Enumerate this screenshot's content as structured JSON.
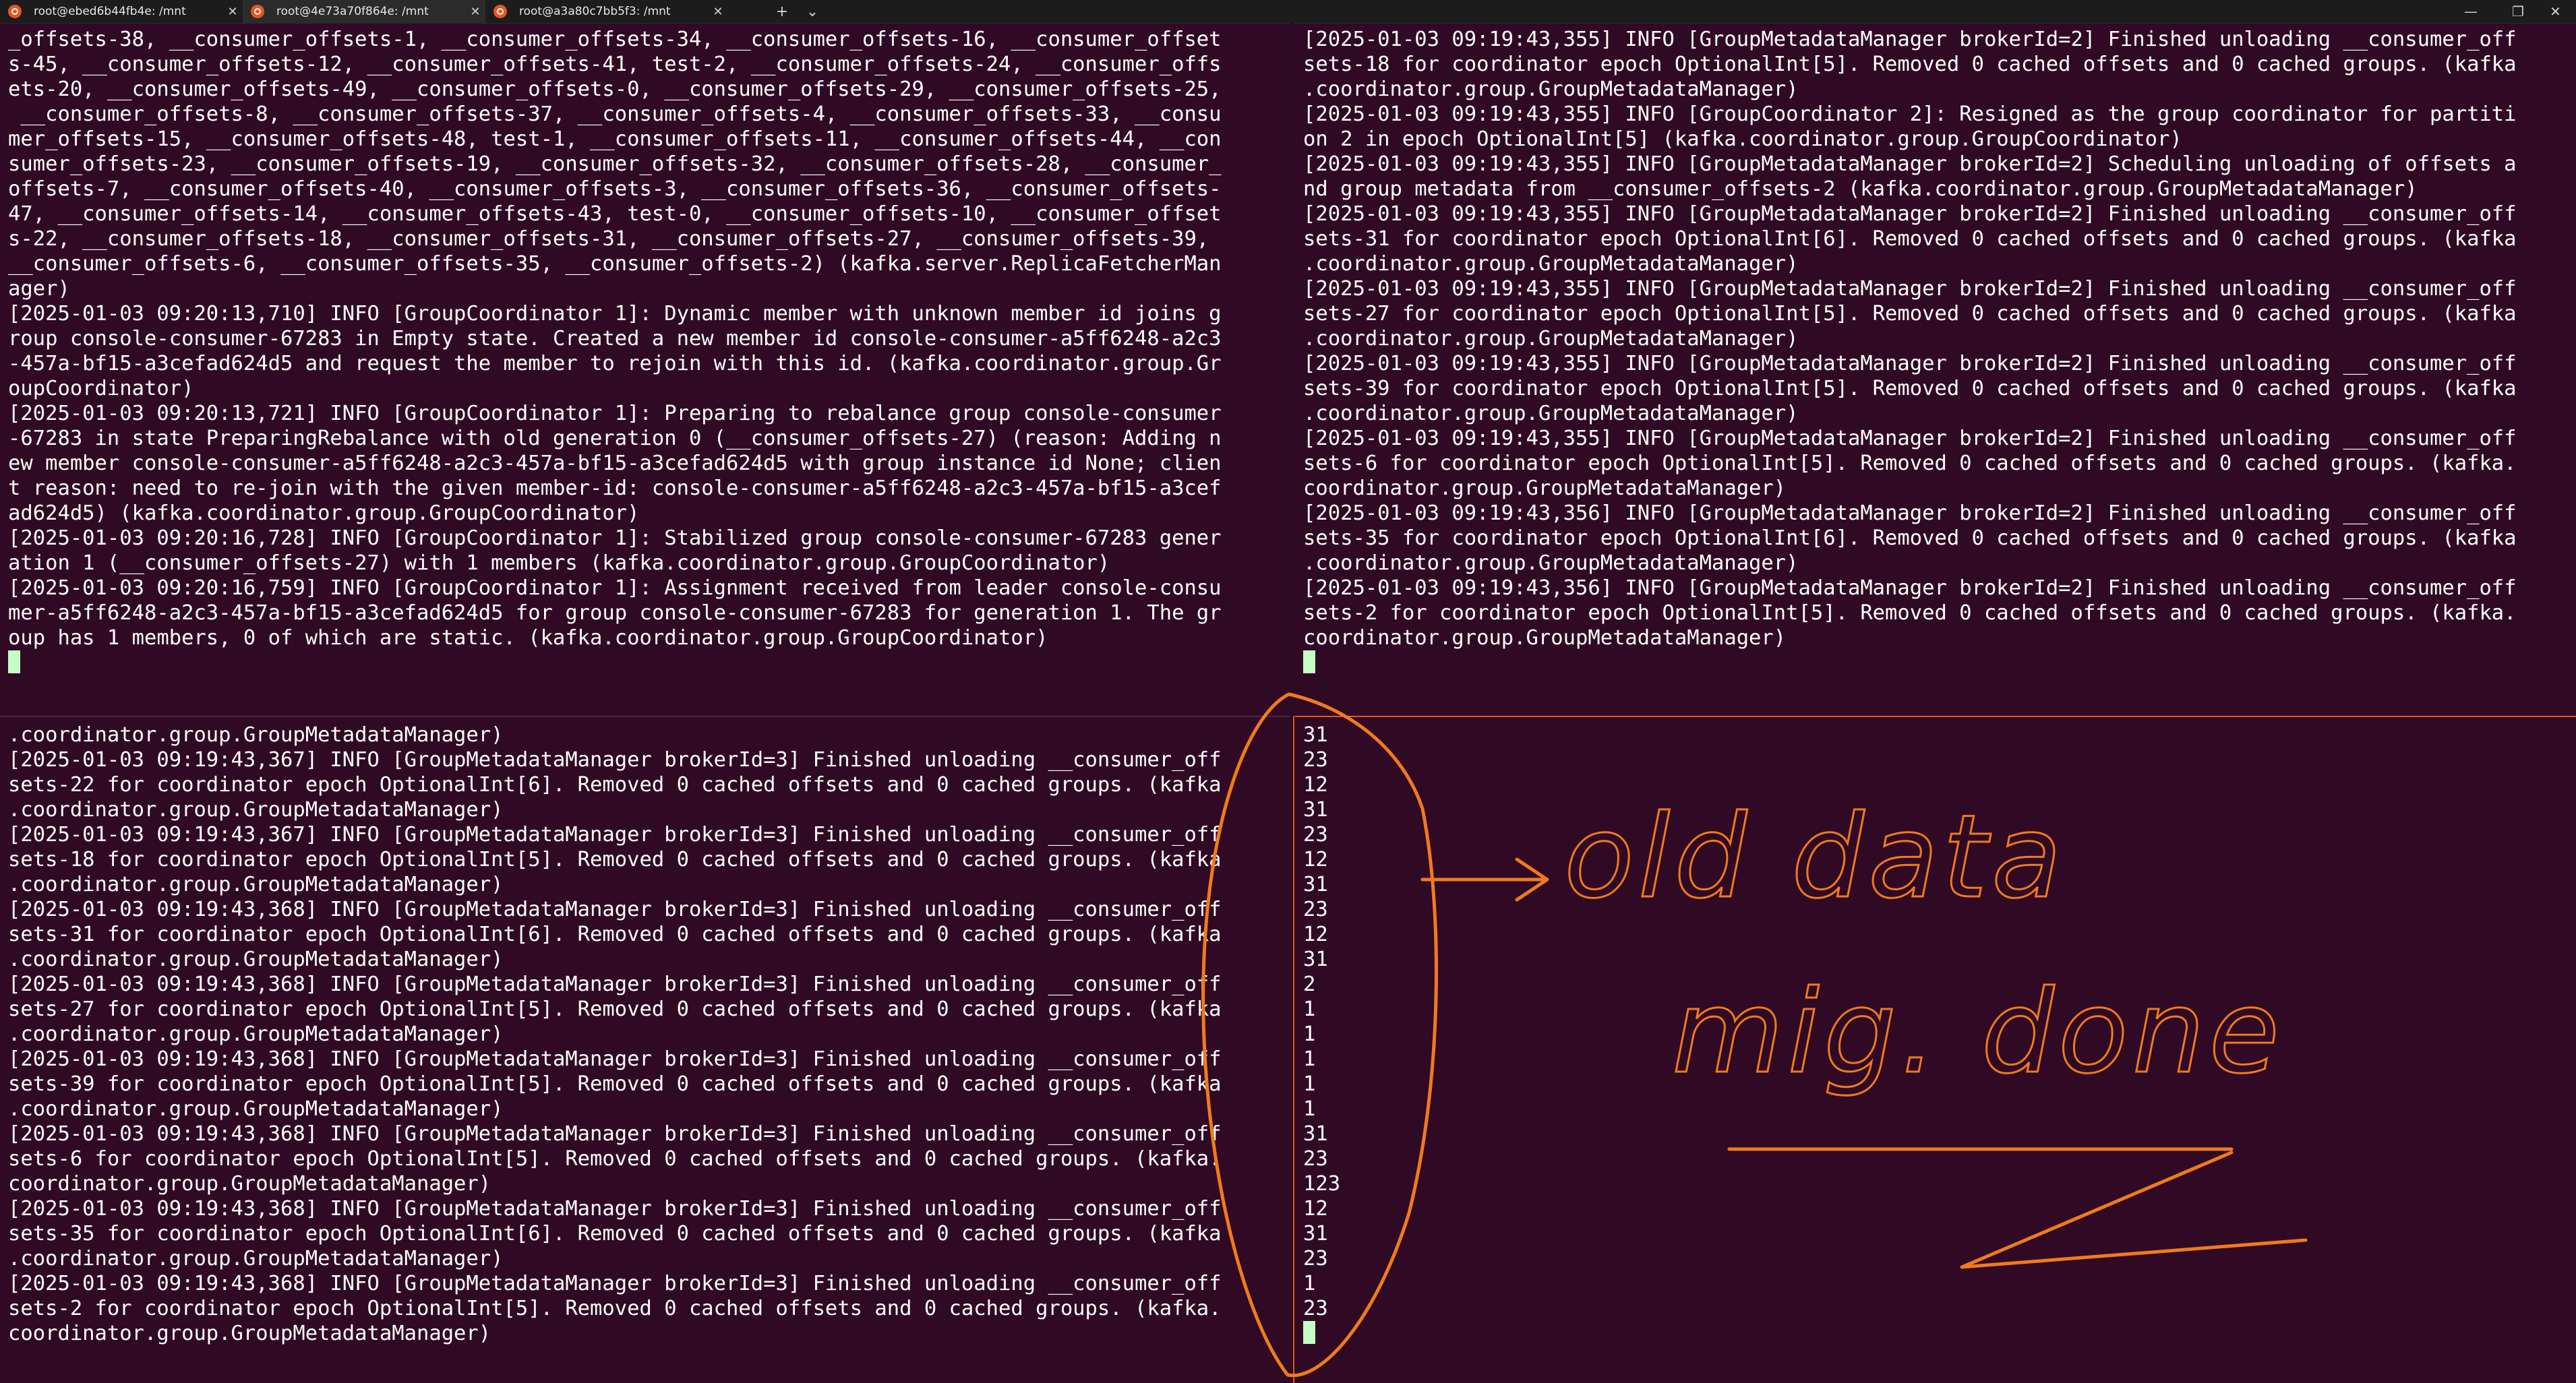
{
  "tabs": [
    {
      "label": "root@ebed6b44fb4e: /mnt",
      "close": "✕",
      "active": false
    },
    {
      "label": "root@4e73a70f864e: /mnt",
      "close": "✕",
      "active": true
    },
    {
      "label": "root@a3a80c7bb5f3: /mnt",
      "close": "✕",
      "active": false
    }
  ],
  "tab_actions": {
    "new_tab": "+",
    "dropdown": "⌄"
  },
  "window_controls": {
    "minimize": "—",
    "restore": "❐",
    "close": "✕"
  },
  "panes": {
    "top_left": "_offsets-38, __consumer_offsets-1, __consumer_offsets-34, __consumer_offsets-16, __consumer_offset\ns-45, __consumer_offsets-12, __consumer_offsets-41, test-2, __consumer_offsets-24, __consumer_offs\nets-20, __consumer_offsets-49, __consumer_offsets-0, __consumer_offsets-29, __consumer_offsets-25,\n __consumer_offsets-8, __consumer_offsets-37, __consumer_offsets-4, __consumer_offsets-33, __consu\nmer_offsets-15, __consumer_offsets-48, test-1, __consumer_offsets-11, __consumer_offsets-44, __con\nsumer_offsets-23, __consumer_offsets-19, __consumer_offsets-32, __consumer_offsets-28, __consumer_\noffsets-7, __consumer_offsets-40, __consumer_offsets-3, __consumer_offsets-36, __consumer_offsets-\n47, __consumer_offsets-14, __consumer_offsets-43, test-0, __consumer_offsets-10, __consumer_offset\ns-22, __consumer_offsets-18, __consumer_offsets-31, __consumer_offsets-27, __consumer_offsets-39,\n__consumer_offsets-6, __consumer_offsets-35, __consumer_offsets-2) (kafka.server.ReplicaFetcherMan\nager)\n[2025-01-03 09:20:13,710] INFO [GroupCoordinator 1]: Dynamic member with unknown member id joins g\nroup console-consumer-67283 in Empty state. Created a new member id console-consumer-a5ff6248-a2c3\n-457a-bf15-a3cefad624d5 and request the member to rejoin with this id. (kafka.coordinator.group.Gr\noupCoordinator)\n[2025-01-03 09:20:13,721] INFO [GroupCoordinator 1]: Preparing to rebalance group console-consumer\n-67283 in state PreparingRebalance with old generation 0 (__consumer_offsets-27) (reason: Adding n\new member console-consumer-a5ff6248-a2c3-457a-bf15-a3cefad624d5 with group instance id None; clien\nt reason: need to re-join with the given member-id: console-consumer-a5ff6248-a2c3-457a-bf15-a3cef\nad624d5) (kafka.coordinator.group.GroupCoordinator)\n[2025-01-03 09:20:16,728] INFO [GroupCoordinator 1]: Stabilized group console-consumer-67283 gener\nation 1 (__consumer_offsets-27) with 1 members (kafka.coordinator.group.GroupCoordinator)\n[2025-01-03 09:20:16,759] INFO [GroupCoordinator 1]: Assignment received from leader console-consu\nmer-a5ff6248-a2c3-457a-bf15-a3cefad624d5 for group console-consumer-67283 for generation 1. The gr\noup has 1 members, 0 of which are static. (kafka.coordinator.group.GroupCoordinator)",
    "top_right": "[2025-01-03 09:19:43,355] INFO [GroupMetadataManager brokerId=2] Finished unloading __consumer_off\nsets-18 for coordinator epoch OptionalInt[5]. Removed 0 cached offsets and 0 cached groups. (kafka\n.coordinator.group.GroupMetadataManager)\n[2025-01-03 09:19:43,355] INFO [GroupCoordinator 2]: Resigned as the group coordinator for partiti\non 2 in epoch OptionalInt[5] (kafka.coordinator.group.GroupCoordinator)\n[2025-01-03 09:19:43,355] INFO [GroupMetadataManager brokerId=2] Scheduling unloading of offsets a\nnd group metadata from __consumer_offsets-2 (kafka.coordinator.group.GroupMetadataManager)\n[2025-01-03 09:19:43,355] INFO [GroupMetadataManager brokerId=2] Finished unloading __consumer_off\nsets-31 for coordinator epoch OptionalInt[6]. Removed 0 cached offsets and 0 cached groups. (kafka\n.coordinator.group.GroupMetadataManager)\n[2025-01-03 09:19:43,355] INFO [GroupMetadataManager brokerId=2] Finished unloading __consumer_off\nsets-27 for coordinator epoch OptionalInt[5]. Removed 0 cached offsets and 0 cached groups. (kafka\n.coordinator.group.GroupMetadataManager)\n[2025-01-03 09:19:43,355] INFO [GroupMetadataManager brokerId=2] Finished unloading __consumer_off\nsets-39 for coordinator epoch OptionalInt[5]. Removed 0 cached offsets and 0 cached groups. (kafka\n.coordinator.group.GroupMetadataManager)\n[2025-01-03 09:19:43,355] INFO [GroupMetadataManager brokerId=2] Finished unloading __consumer_off\nsets-6 for coordinator epoch OptionalInt[5]. Removed 0 cached offsets and 0 cached groups. (kafka.\ncoordinator.group.GroupMetadataManager)\n[2025-01-03 09:19:43,356] INFO [GroupMetadataManager brokerId=2] Finished unloading __consumer_off\nsets-35 for coordinator epoch OptionalInt[6]. Removed 0 cached offsets and 0 cached groups. (kafka\n.coordinator.group.GroupMetadataManager)\n[2025-01-03 09:19:43,356] INFO [GroupMetadataManager brokerId=2] Finished unloading __consumer_off\nsets-2 for coordinator epoch OptionalInt[5]. Removed 0 cached offsets and 0 cached groups. (kafka.\ncoordinator.group.GroupMetadataManager)",
    "bottom_left": ".coordinator.group.GroupMetadataManager)\n[2025-01-03 09:19:43,367] INFO [GroupMetadataManager brokerId=3] Finished unloading __consumer_off\nsets-22 for coordinator epoch OptionalInt[6]. Removed 0 cached offsets and 0 cached groups. (kafka\n.coordinator.group.GroupMetadataManager)\n[2025-01-03 09:19:43,367] INFO [GroupMetadataManager brokerId=3] Finished unloading __consumer_off\nsets-18 for coordinator epoch OptionalInt[5]. Removed 0 cached offsets and 0 cached groups. (kafka\n.coordinator.group.GroupMetadataManager)\n[2025-01-03 09:19:43,368] INFO [GroupMetadataManager brokerId=3] Finished unloading __consumer_off\nsets-31 for coordinator epoch OptionalInt[6]. Removed 0 cached offsets and 0 cached groups. (kafka\n.coordinator.group.GroupMetadataManager)\n[2025-01-03 09:19:43,368] INFO [GroupMetadataManager brokerId=3] Finished unloading __consumer_off\nsets-27 for coordinator epoch OptionalInt[5]. Removed 0 cached offsets and 0 cached groups. (kafka\n.coordinator.group.GroupMetadataManager)\n[2025-01-03 09:19:43,368] INFO [GroupMetadataManager brokerId=3] Finished unloading __consumer_off\nsets-39 for coordinator epoch OptionalInt[5]. Removed 0 cached offsets and 0 cached groups. (kafka\n.coordinator.group.GroupMetadataManager)\n[2025-01-03 09:19:43,368] INFO [GroupMetadataManager brokerId=3] Finished unloading __consumer_off\nsets-6 for coordinator epoch OptionalInt[5]. Removed 0 cached offsets and 0 cached groups. (kafka.\ncoordinator.group.GroupMetadataManager)\n[2025-01-03 09:19:43,368] INFO [GroupMetadataManager brokerId=3] Finished unloading __consumer_off\nsets-35 for coordinator epoch OptionalInt[6]. Removed 0 cached offsets and 0 cached groups. (kafka\n.coordinator.group.GroupMetadataManager)\n[2025-01-03 09:19:43,368] INFO [GroupMetadataManager brokerId=3] Finished unloading __consumer_off\nsets-2 for coordinator epoch OptionalInt[5]. Removed 0 cached offsets and 0 cached groups. (kafka.\ncoordinator.group.GroupMetadataManager)",
    "bottom_right": "31\n23\n12\n31\n23\n12\n31\n23\n12\n31\n2\n1\n1\n1\n1\n1\n31\n23\n123\n12\n31\n23\n1\n23"
  },
  "annotation": {
    "line1": "old data",
    "line2": "mig. done",
    "color": "#f07a1e"
  },
  "colors": {
    "terminal_bg": "#300a24",
    "text": "#ffffff",
    "cursor": "#c5ffc5",
    "active_pane_border": "#e2571a"
  }
}
